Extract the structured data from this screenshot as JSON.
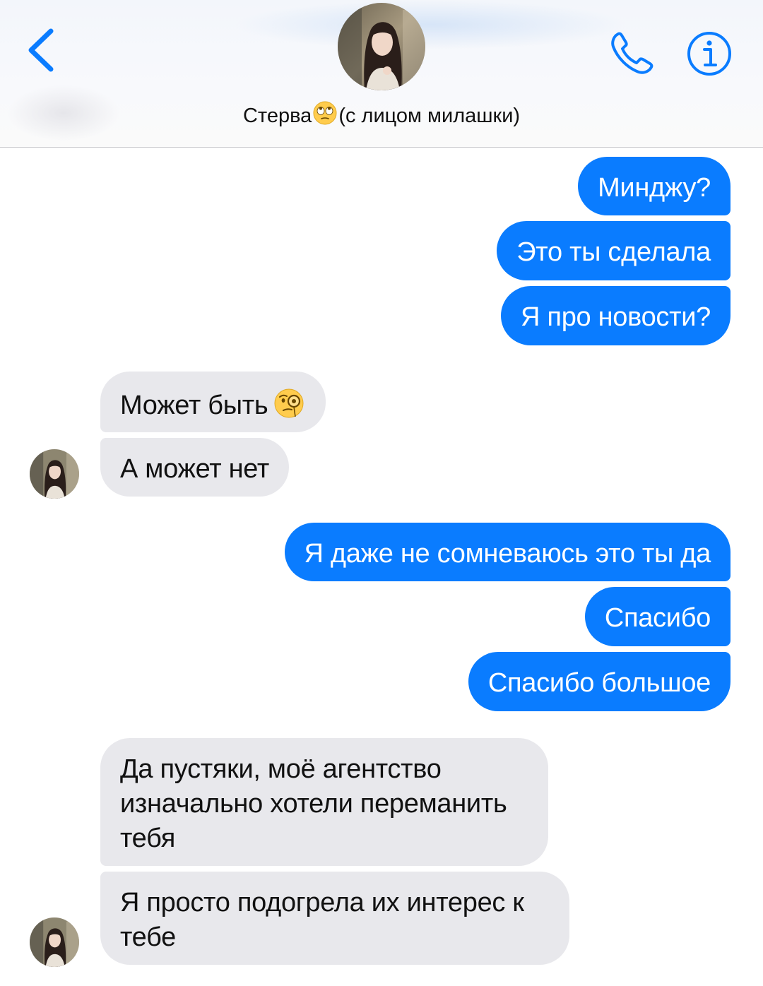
{
  "header": {
    "back_icon": "chevron-left-icon",
    "phone_icon": "phone-icon",
    "info_icon": "info-icon",
    "contact_name_prefix": "Стерва",
    "contact_name_emoji": "face-with-rolling-eyes",
    "contact_name_suffix": "(с лицом милашки)",
    "accent_color": "#0a7cff"
  },
  "messages": [
    {
      "side": "outgoing",
      "text": "Минджу?"
    },
    {
      "side": "outgoing",
      "text": "Это ты сделала"
    },
    {
      "side": "outgoing",
      "text": "Я про новости?"
    },
    {
      "side": "incoming",
      "text": "Может быть",
      "emoji": "face-with-monocle"
    },
    {
      "side": "incoming",
      "text": "А может нет"
    },
    {
      "side": "outgoing",
      "text": "Я даже не сомневаюсь это ты да"
    },
    {
      "side": "outgoing",
      "text": "Спасибо"
    },
    {
      "side": "outgoing",
      "text": "Спасибо большое"
    },
    {
      "side": "incoming",
      "text": "Да пустяки, моё агентство изначально хотели переманить тебя"
    },
    {
      "side": "incoming",
      "text": "Я просто подогрела их интерес к тебе"
    }
  ],
  "colors": {
    "outgoing_bubble": "#0a7cff",
    "incoming_bubble": "#e8e8ec",
    "outgoing_text": "#ffffff",
    "incoming_text": "#111111"
  }
}
